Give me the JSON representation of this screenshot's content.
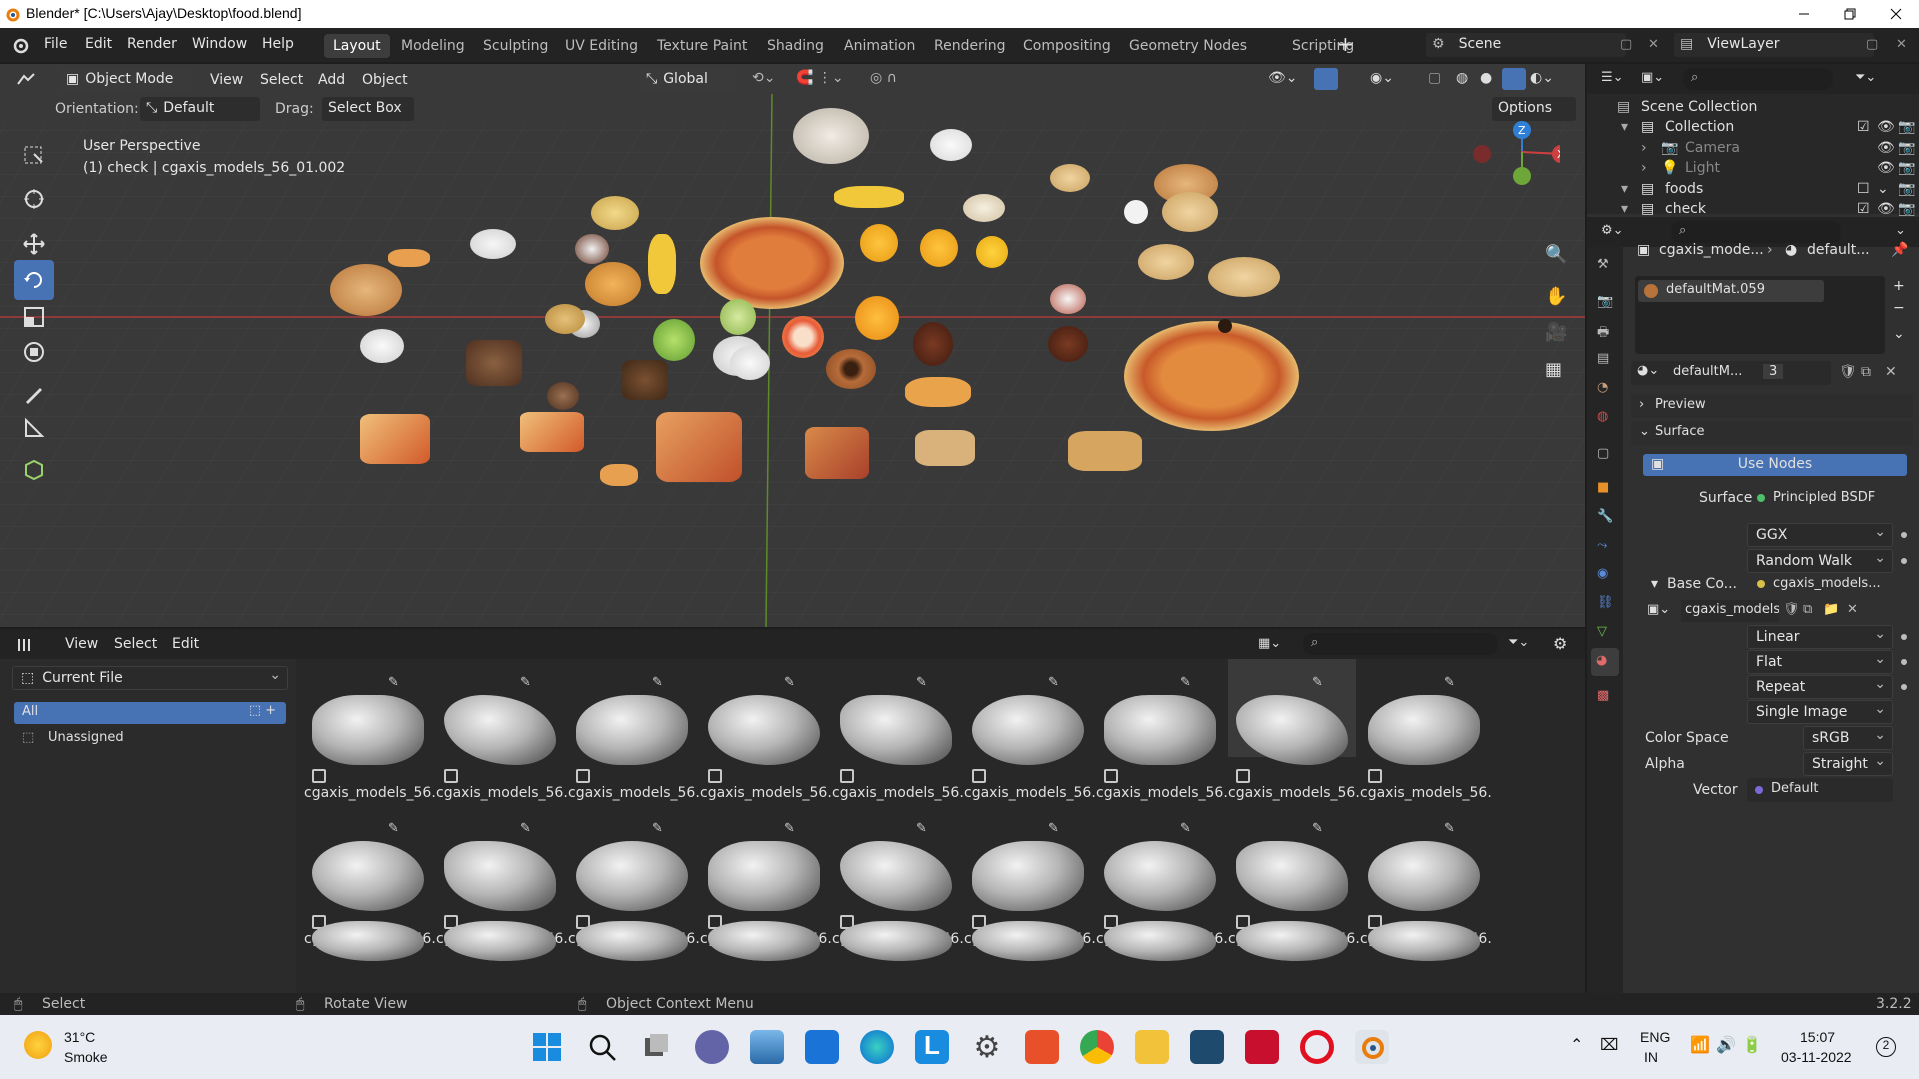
{
  "window": {
    "title": "Blender* [C:\\Users\\Ajay\\Desktop\\food.blend]"
  },
  "menu": [
    "File",
    "Edit",
    "Render",
    "Window",
    "Help"
  ],
  "workspaces": [
    "Layout",
    "Modeling",
    "Sculpting",
    "UV Editing",
    "Texture Paint",
    "Shading",
    "Animation",
    "Rendering",
    "Compositing",
    "Geometry Nodes",
    "Scripting"
  ],
  "scene": {
    "name": "Scene",
    "view_layer": "ViewLayer"
  },
  "viewport": {
    "mode": "Object Mode",
    "menus": [
      "View",
      "Select",
      "Add",
      "Object"
    ],
    "transform": "Global",
    "orientation_label": "Orientation:",
    "orientation": "Default",
    "drag_label": "Drag:",
    "drag": "Select Box",
    "options": "Options",
    "perspective": "User Perspective",
    "active": "(1) check | cgaxis_models_56_01.002",
    "gizmo": {
      "x": "X",
      "y": "Y",
      "z": "Z"
    }
  },
  "assets": {
    "menus": [
      "View",
      "Select",
      "Edit"
    ],
    "library": "Current File",
    "catalogs": [
      "All",
      "Unassigned"
    ],
    "item_label": "cgaxis_models_56...",
    "row_count": 3
  },
  "outliner": {
    "scene_collection": "Scene Collection",
    "items": [
      {
        "name": "Collection",
        "indent": 0
      },
      {
        "name": "Camera",
        "indent": 1
      },
      {
        "name": "Light",
        "indent": 1
      },
      {
        "name": "foods",
        "indent": 0
      },
      {
        "name": "check",
        "indent": 0
      }
    ]
  },
  "properties": {
    "breadcrumb_object": "cgaxis_mode...",
    "breadcrumb_material": "default...",
    "slot": "defaultMat.059",
    "material_name": "defaultM...",
    "users": "3",
    "preview": "Preview",
    "surface_panel": "Surface",
    "use_nodes": "Use Nodes",
    "surface_label": "Surface",
    "surface_value": "Principled BSDF",
    "distribution": "GGX",
    "subsurface": "Random Walk",
    "base_color_label": "Base Co...",
    "base_color_value": "cgaxis_models...",
    "image": "cgaxis_models...",
    "interpolation": "Linear",
    "projection": "Flat",
    "extension": "Repeat",
    "source": "Single Image",
    "color_space_label": "Color Space",
    "color_space": "sRGB",
    "alpha_label": "Alpha",
    "alpha": "Straight",
    "vector_label": "Vector",
    "vector": "Default"
  },
  "status": {
    "select": "Select",
    "rotate": "Rotate View",
    "context": "Object Context Menu",
    "version": "3.2.2"
  },
  "taskbar": {
    "temp": "31°C",
    "weather": "Smoke",
    "lang1": "ENG",
    "lang2": "IN",
    "time": "15:07",
    "date": "03-11-2022",
    "badge": "2"
  }
}
